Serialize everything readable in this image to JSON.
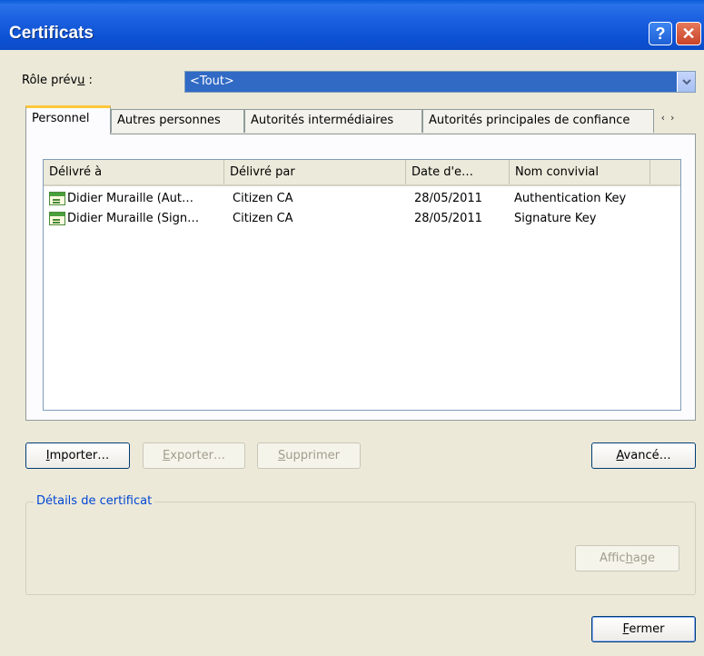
{
  "window": {
    "title": "Certificats"
  },
  "titlebar_buttons": {
    "help": "?",
    "close": "✕"
  },
  "role": {
    "label_pre": "Rôle prév",
    "label_mnemonic": "u",
    "label_post": " :",
    "value": "<Tout>"
  },
  "tabs": [
    {
      "label": "Personnel",
      "active": true
    },
    {
      "label": "Autres personnes",
      "active": false
    },
    {
      "label": "Autorités intermédiaires",
      "active": false
    },
    {
      "label": "Autorités principales de confiance",
      "active": false
    }
  ],
  "tab_scroll": {
    "left": "‹",
    "right": "›"
  },
  "table": {
    "columns": [
      "Délivré à",
      "Délivré par",
      "Date d'e…",
      "Nom convivial"
    ],
    "rows": [
      {
        "issued_to": "Didier Muraille (Aut…",
        "issued_by": "Citizen CA",
        "date": "28/05/2011",
        "friendly_name": "Authentication Key",
        "icon": "certificate-icon"
      },
      {
        "issued_to": "Didier Muraille (Sign…",
        "issued_by": "Citizen CA",
        "date": "28/05/2011",
        "friendly_name": "Signature Key",
        "icon": "certificate-icon"
      }
    ]
  },
  "buttons": {
    "import": {
      "mnemonic": "I",
      "rest": "mporter…"
    },
    "export": {
      "mnemonic": "E",
      "rest": "xporter…"
    },
    "remove": {
      "mnemonic": "S",
      "rest": "upprimer"
    },
    "advanced": {
      "mnemonic": "A",
      "rest": "vancé…"
    },
    "view": {
      "pre": "Affic",
      "mnemonic": "h",
      "rest": "age"
    },
    "close": {
      "mnemonic": "F",
      "rest": "ermer"
    }
  },
  "details": {
    "legend": "Détails de certificat"
  },
  "colors": {
    "titlebar": "#0b4cc8",
    "selection": "#316ac5",
    "dialog_bg": "#ece9d8",
    "groupbox_legend": "#0046d5"
  }
}
